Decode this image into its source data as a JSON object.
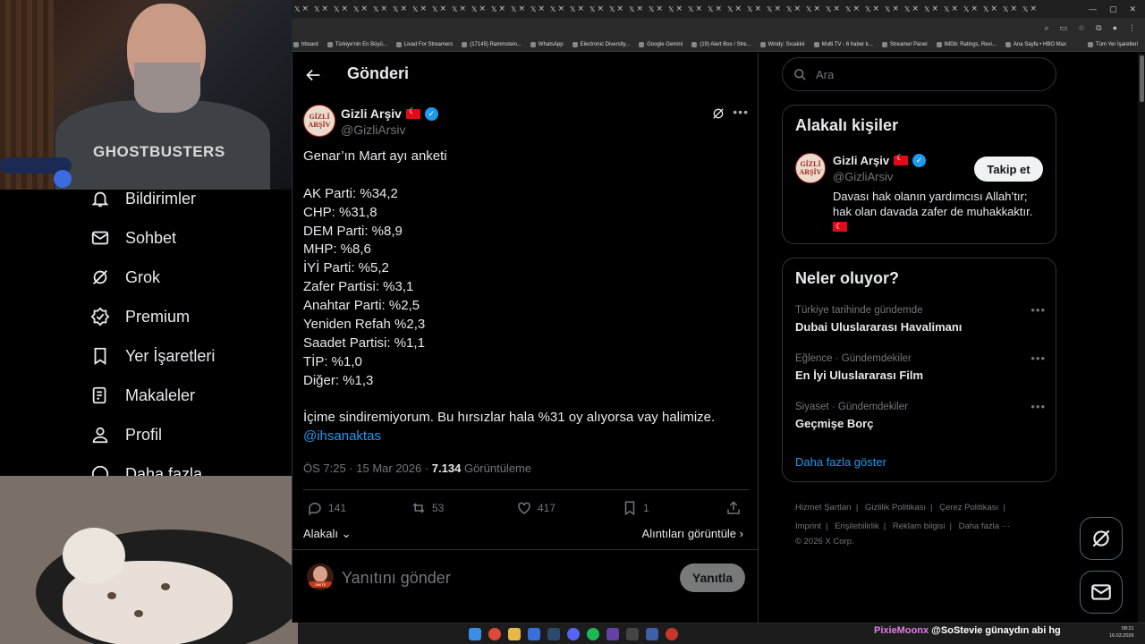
{
  "browser": {
    "tab_count": 38,
    "bookmarks": [
      "hboard",
      "Türkiye'nin En Büyü...",
      "Livad For Streamers",
      "(17145) Rammstein...",
      "WhatsApp",
      "Electronic Diversity...",
      "Google Gemini",
      "(19) Alert Box / Stre...",
      "Windy: Sıcaklık",
      "Multi TV - 6 haber k...",
      "Streamer Panel",
      "IMDb: Ratings, Revi...",
      "Ana Sayfa • HBO Max"
    ],
    "bookmarks_right": "Tüm Yer İşaretleri"
  },
  "webcam": {
    "shirt_text": "GHOSTBUSTERS"
  },
  "leftnav": {
    "items": [
      {
        "label": "Bildirimler",
        "icon": "bell-icon"
      },
      {
        "label": "Sohbet",
        "icon": "mail-icon"
      },
      {
        "label": "Grok",
        "icon": "grok-icon"
      },
      {
        "label": "Premium",
        "icon": "verified-badge-icon"
      },
      {
        "label": "Yer İşaretleri",
        "icon": "bookmark-icon"
      },
      {
        "label": "Makaleler",
        "icon": "article-icon"
      },
      {
        "label": "Profil",
        "icon": "person-icon"
      },
      {
        "label": "Daha fazla",
        "icon": "more-circle-icon"
      }
    ]
  },
  "post": {
    "header_title": "Gönderi",
    "author": {
      "name": "Gizli Arşiv",
      "handle": "@GizliArsiv",
      "avatar_text_1": "GİZLİ",
      "avatar_text_2": "ARŞİV"
    },
    "text_intro": "Genar’ın Mart ayı anketi",
    "results": [
      "AK Parti: %34,2",
      "CHP: %31,8",
      "DEM Parti: %8,9",
      "MHP: %8,6",
      "İYİ Parti: %5,2",
      "Zafer Partisi: %3,1",
      "Anahtar Parti: %2,5",
      "Yeniden Refah %2,3",
      "Saadet Partisi: %1,1",
      "TİP: %1,0",
      "Diğer: %1,3"
    ],
    "comment": "İçime sindiremiyorum. Bu hırsızlar hala %31 oy alıyorsa vay halimize.",
    "mention": "@ihsanaktas",
    "time": "ÖS 7:25 · 15 Mar 2026 · ",
    "views": "7.134",
    "views_label": " Görüntüleme",
    "stats": {
      "replies": "141",
      "reposts": "53",
      "likes": "417",
      "bookmarks": "1"
    },
    "relevance_label": "Alakalı",
    "quotes_label": "Alıntıları görüntüle",
    "reply_placeholder": "Yanıtını gönder",
    "reply_button": "Yanıtla",
    "reply_avatar_band": "JIMITE"
  },
  "sidebar": {
    "search_placeholder": "Ara",
    "related": {
      "title": "Alakalı kişiler",
      "name": "Gizli Arşiv",
      "handle": "@GizliArsiv",
      "follow_label": "Takip et",
      "bio": "Davası hak olanın yardımcısı Allah’tır; hak olan davada zafer de muhakkaktır."
    },
    "trends": {
      "title": "Neler oluyor?",
      "items": [
        {
          "category": "Türkiye tarihinde gündemde",
          "title": "Dubai Uluslararası Havalimanı"
        },
        {
          "category": "Eğlence · Gündemdekiler",
          "title": "En İyi Uluslararası Film"
        },
        {
          "category": "Siyaset · Gündemdekiler",
          "title": "Geçmişe Borç"
        }
      ],
      "show_more": "Daha fazla göster"
    },
    "footer": {
      "links": [
        "Hizmet Şartları",
        "Gizlilik Politikası",
        "Çerez Politikası",
        "Imprint",
        "Erişilebilirlik",
        "Reklam bilgisi",
        "Daha fazla ···"
      ],
      "copyright": "© 2026 X Corp."
    }
  },
  "taskbar": {
    "chat_user": "PixieMoonx",
    "chat_message": " @SoStevie günaydın abi hg",
    "time": "08:21",
    "date": "16.03.2026"
  },
  "colors": {
    "accent": "#1d9bf0",
    "text": "#e7e9ea",
    "muted": "#71767b",
    "border": "#2f3336",
    "flag": "#e30a17"
  }
}
